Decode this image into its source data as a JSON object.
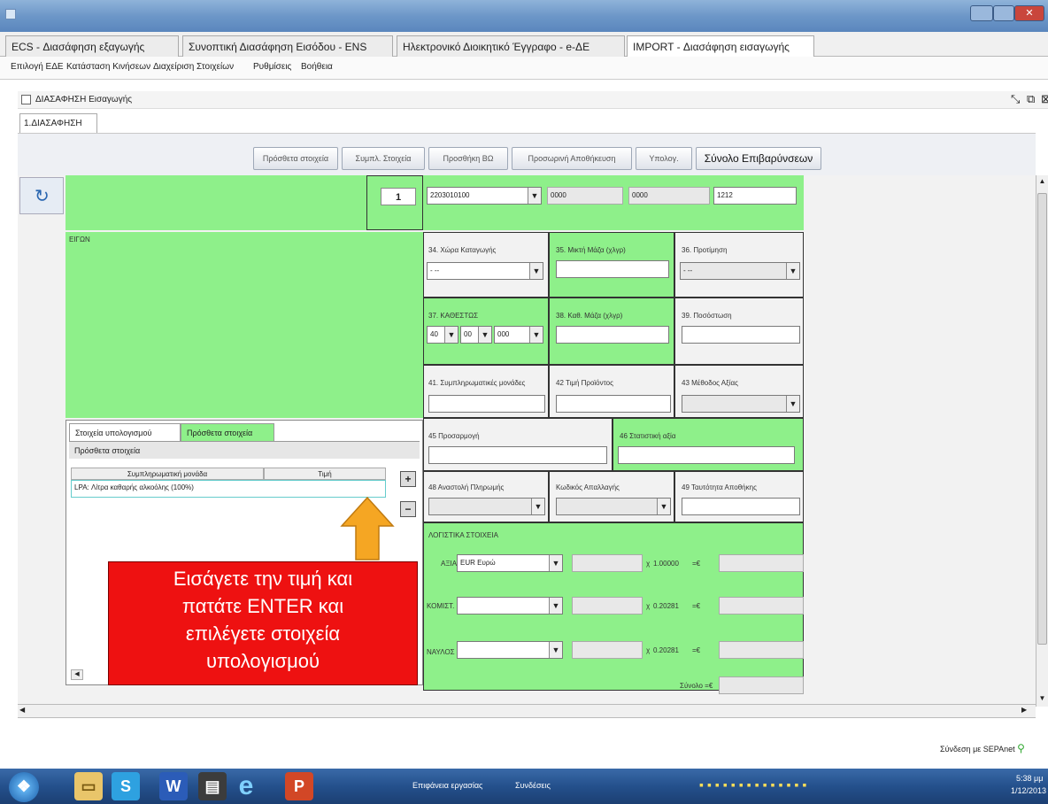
{
  "tabs": [
    {
      "label": "ECS - Διασάφηση εξαγωγής"
    },
    {
      "label": "Συνοπτική Διασάφηση Εισόδου - ENS"
    },
    {
      "label": "Ηλεκτρονικό Διοικητικό Έγγραφο - e-ΔΕ"
    },
    {
      "label": "IMPORT - Διασάφηση εισαγωγής"
    }
  ],
  "menu": [
    "Επιλογή ΕΔΕ",
    "Κατάσταση Κινήσεων",
    "Διαχείριση Στοιχείων",
    "Ρυθμίσεις",
    "Βοήθεια"
  ],
  "frame": {
    "title": "ΔΙΑΣΑΦΗΣΗ Εισαγωγής",
    "subtab": "1.ΔΙΑΣΑΦΗΣΗ"
  },
  "toolbar": {
    "buttons": [
      "Πρόσθετα στοιχεία",
      "Συμπλ. Στοιχεία",
      "Προσθήκη ΒΩ",
      "Προσωρινή Αποθήκευση",
      "Υπολογ.",
      "Σύνολο Επιβαρύνσεων"
    ]
  },
  "item": {
    "number": "1",
    "commodity_code": "2203010100",
    "code2": "0000",
    "code3": "0000",
    "code4": "1212",
    "description_label": "ΕΙΓΩΝ"
  },
  "fields": {
    "country_origin": {
      "label": "34. Χώρα Καταγωγής",
      "value": "- --"
    },
    "gross_mass": {
      "label": "35. Μικτή Μάζα (χλγρ)",
      "value": ""
    },
    "preference": {
      "label": "36. Προτίμηση",
      "value": "- --"
    },
    "procedure": {
      "label": "37. ΚΑΘΕΣΤΩΣ",
      "values": [
        "40",
        "00",
        "000"
      ]
    },
    "net_mass": {
      "label": "38. Καθ. Μάζα (χλγρ)",
      "value": ""
    },
    "quota": {
      "label": "39. Ποσόστωση",
      "value": ""
    },
    "supplementary_units": {
      "label": "41. Συμπληρωματικές μονάδες",
      "value": ""
    },
    "item_price": {
      "label": "42 Τιμή Προϊόντος",
      "value": ""
    },
    "valuation_method": {
      "label": "43 Μέθοδος Αξίας",
      "value": ""
    },
    "preference_code": {
      "label": "45 Προσαρμογή",
      "value": ""
    },
    "statistical_value": {
      "label": "46 Στατιστική αξία",
      "value": ""
    },
    "payment_method": {
      "label": "48 Αναστολή Πληρωμής",
      "value": ""
    },
    "exemption_code": {
      "label": "Κωδικός Απαλλαγής",
      "value": ""
    },
    "warehouse_id": {
      "label": "49 Ταυτότητα Αποθήκης",
      "value": ""
    }
  },
  "accounting": {
    "title": "ΛΟΓΙΣΤΙΚΑ ΣΤΟΙΧΕΙΑ",
    "rows": [
      {
        "label": "ΑΞΙΑ",
        "currency": "EUR Ευρώ",
        "rate": "1.00000",
        "suffix": "=€"
      },
      {
        "label": "ΚΟΜΙΣΤ.",
        "currency": "",
        "rate": "0.20281",
        "suffix": "=€"
      },
      {
        "label": "ΝΑΥΛΟΣ",
        "currency": "",
        "rate": "0.20281",
        "suffix": "=€"
      }
    ],
    "total_label": "Σύνολο =€",
    "times": "χ"
  },
  "panel": {
    "tab1": "Στοιχεία υπολογισμού",
    "tab2": "Πρόσθετα στοιχεία",
    "header": "Πρόσθετα στοιχεία",
    "columns": [
      "Συμπληρωματική μονάδα",
      "Τιμή"
    ],
    "rows": [
      {
        "unit": "LPA: Λίτρα καθαρής αλκοόλης (100%)",
        "value": ""
      }
    ],
    "add": "+",
    "remove": "−"
  },
  "callout": {
    "lines": [
      "Εισάγετε την τιμή και",
      "πατάτε ENTER και",
      "επιλέγετε  στοιχεία",
      "υπολογισμού"
    ]
  },
  "status": {
    "connection": "Σύνδεση με SEPAnet"
  },
  "taskbar": {
    "items": [
      "Επιφάνεια εργασίας",
      "Συνδέσεις"
    ],
    "time": "5:38 μμ",
    "date": "1/12/2013"
  },
  "colors": {
    "green_panel": "#8ef08a",
    "callout_red": "#ee1111",
    "arrow_orange": "#f5a623"
  }
}
